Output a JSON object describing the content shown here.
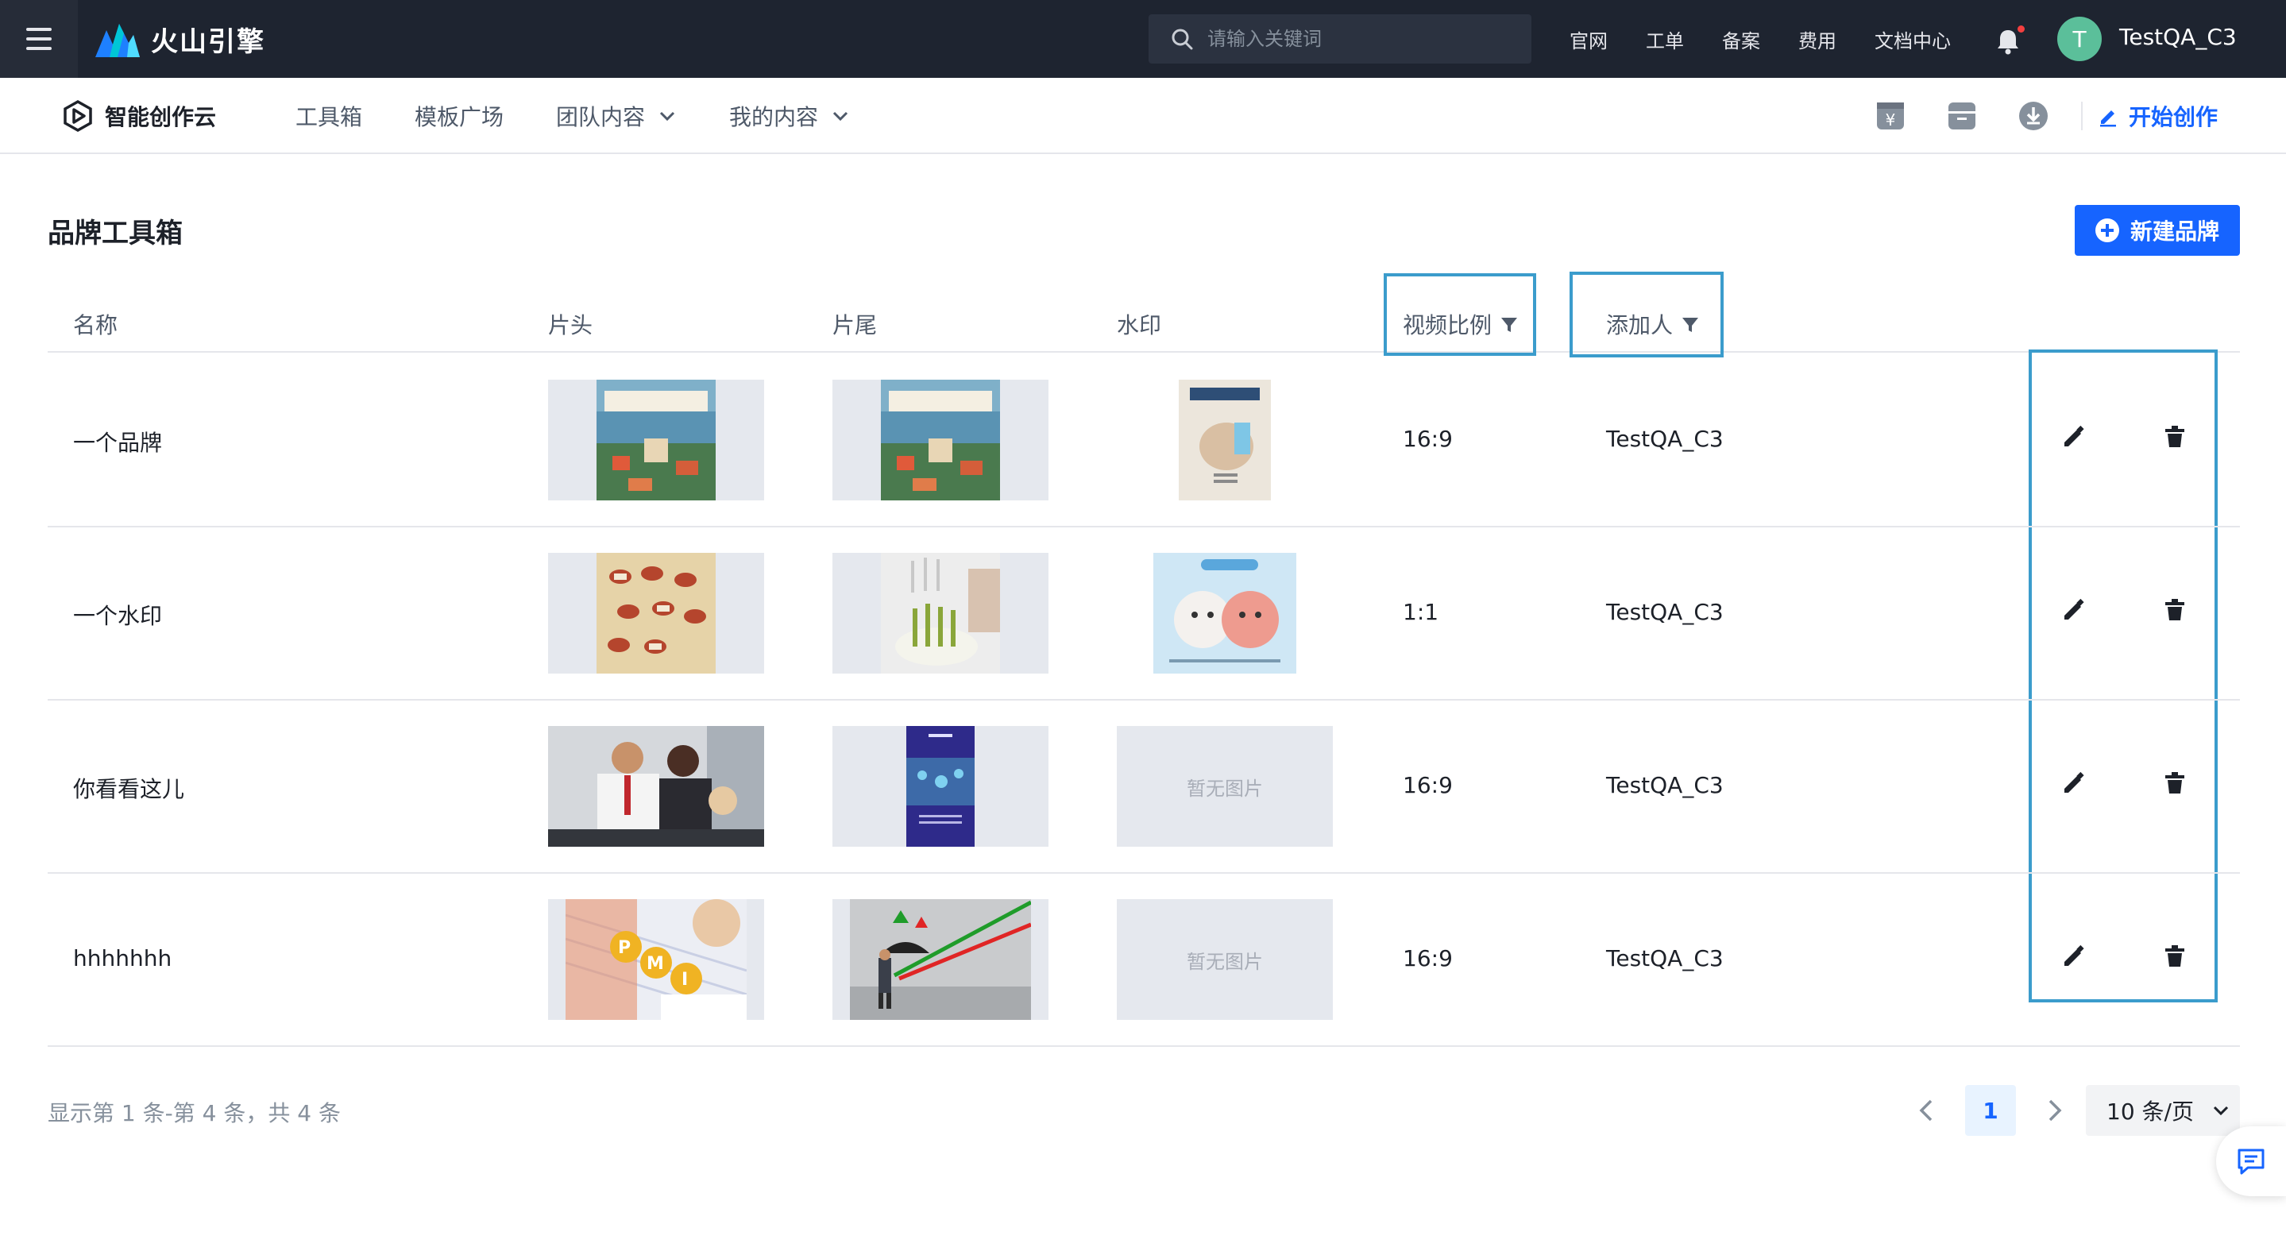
{
  "topbar": {
    "brand": "火山引擎",
    "search_placeholder": "请输入关键词",
    "nav": [
      "官网",
      "工单",
      "备案",
      "费用",
      "文档中心"
    ],
    "avatar_initial": "T",
    "username": "TestQA_C3"
  },
  "subnav": {
    "brand": "智能创作云",
    "items": [
      "工具箱",
      "模板广场",
      "团队内容",
      "我的内容"
    ],
    "start_create": "开始创作"
  },
  "page": {
    "title": "品牌工具箱",
    "new_brand_button": "新建品牌"
  },
  "table": {
    "columns": [
      "名称",
      "片头",
      "片尾",
      "水印",
      "视频比例",
      "添加人"
    ],
    "rows": [
      {
        "name": "一个品牌",
        "ratio": "16:9",
        "added_by": "TestQA_C3"
      },
      {
        "name": "一个水印",
        "ratio": "1:1",
        "added_by": "TestQA_C3"
      },
      {
        "name": "你看看这儿",
        "ratio": "16:9",
        "added_by": "TestQA_C3",
        "watermark_empty": "暂无图片"
      },
      {
        "name": "hhhhhhh",
        "ratio": "16:9",
        "added_by": "TestQA_C3",
        "watermark_empty": "暂无图片"
      }
    ]
  },
  "footer": {
    "summary": "显示第 1 条-第 4 条，共 4 条",
    "current_page": "1",
    "page_size": "10 条/页"
  },
  "colors": {
    "topbar_bg": "#1e2430",
    "primary": "#1664ff",
    "highlight_box": "#3b9ccc"
  }
}
